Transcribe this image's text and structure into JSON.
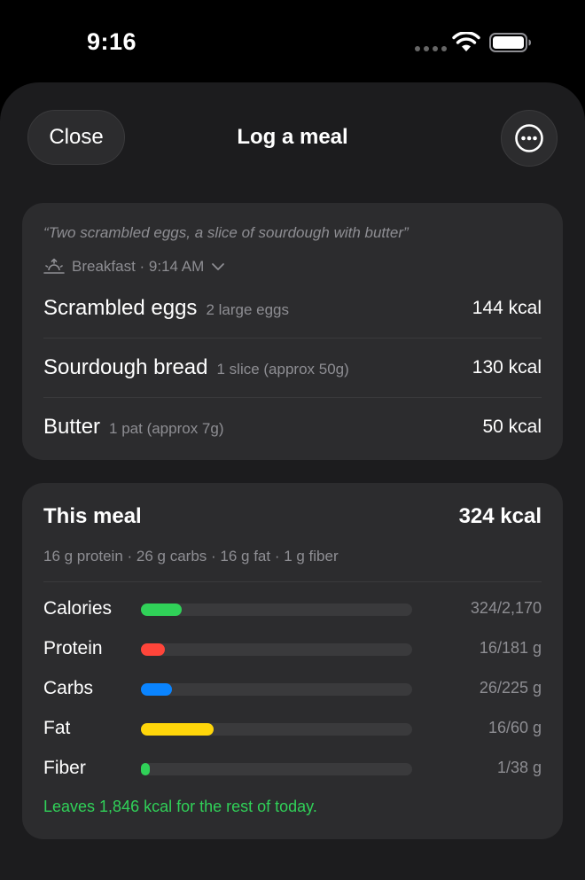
{
  "status_bar": {
    "time": "9:16"
  },
  "header": {
    "close_label": "Close",
    "title": "Log a meal"
  },
  "entry": {
    "quote": "“Two scrambled eggs, a slice of sourdough with butter”",
    "meal": "Breakfast · 9:14 AM",
    "items": [
      {
        "name": "Scrambled eggs",
        "portion": "2 large eggs",
        "kcal": "144 kcal"
      },
      {
        "name": "Sourdough bread",
        "portion": "1 slice (approx 50g)",
        "kcal": "130 kcal"
      },
      {
        "name": "Butter",
        "portion": "1 pat (approx 7g)",
        "kcal": "50 kcal"
      }
    ]
  },
  "summary": {
    "title": "This meal",
    "total_kcal": "324 kcal",
    "breakdown": "16 g protein · 26 g carbs · 16 g fat · 1 g fiber",
    "macros": [
      {
        "label": "Calories",
        "value": "324/2,170",
        "fraction": 0.149,
        "color": "#30d158"
      },
      {
        "label": "Protein",
        "value": "16/181 g",
        "fraction": 0.088,
        "color": "#ff453a"
      },
      {
        "label": "Carbs",
        "value": "26/225 g",
        "fraction": 0.116,
        "color": "#0a84ff"
      },
      {
        "label": "Fat",
        "value": "16/60 g",
        "fraction": 0.267,
        "color": "#ffd60a"
      },
      {
        "label": "Fiber",
        "value": "1/38 g",
        "fraction": 0.026,
        "color": "#30d158"
      }
    ],
    "leaves_text": "Leaves 1,846 kcal for the rest of today."
  }
}
